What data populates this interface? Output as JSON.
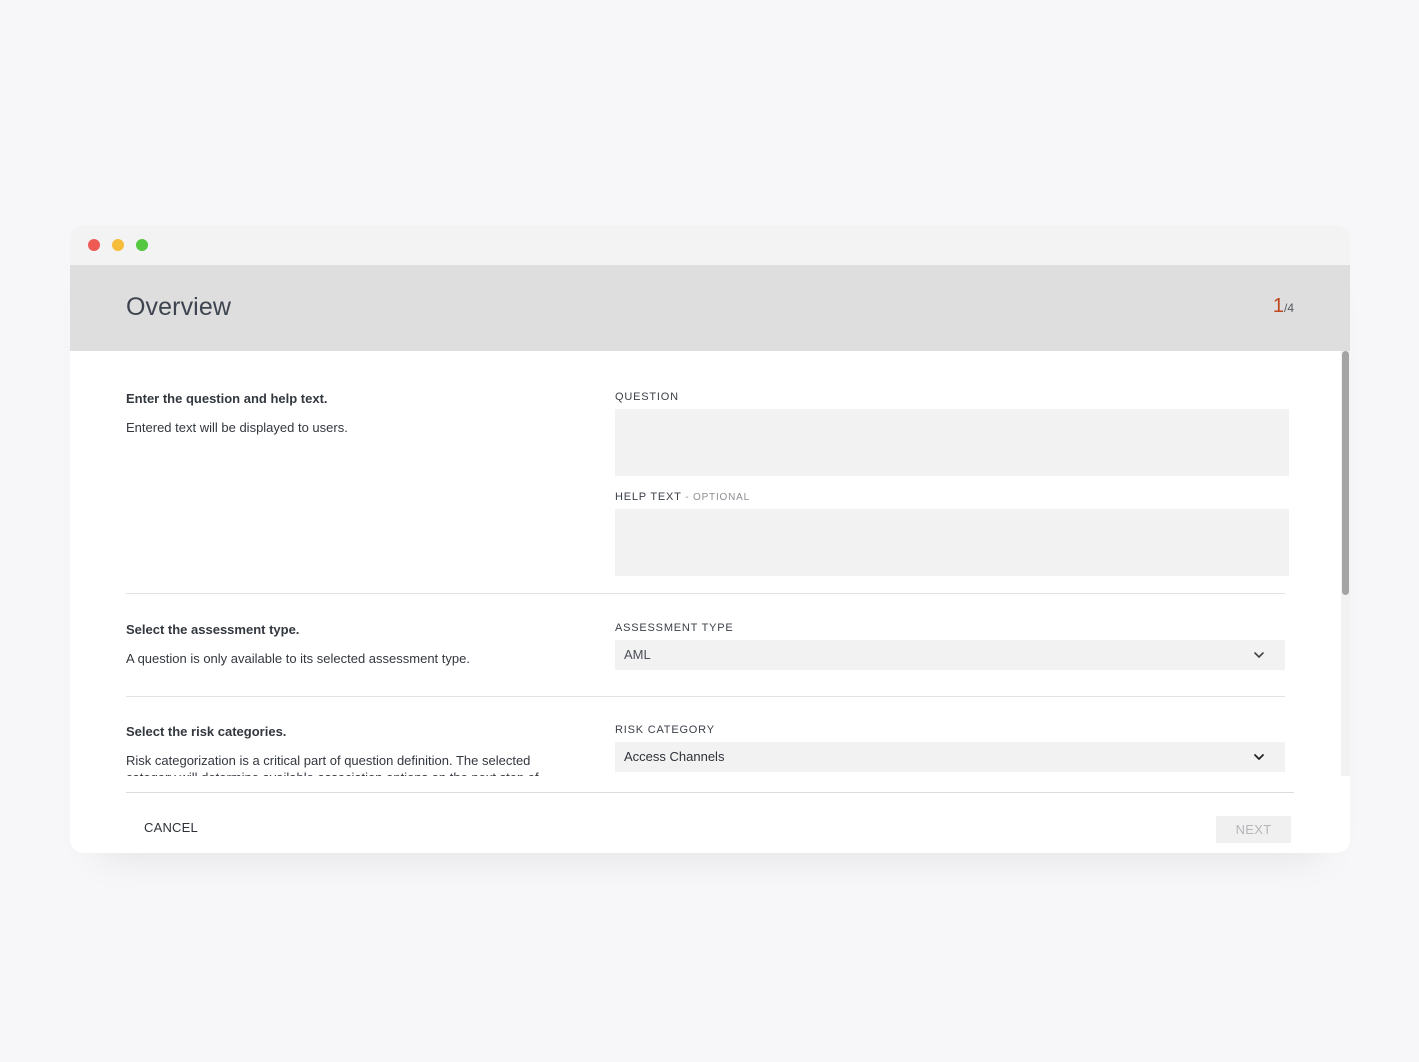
{
  "header": {
    "title": "Overview",
    "step_current": "1",
    "step_total": "/4"
  },
  "sections": {
    "question": {
      "heading": "Enter the question and help text.",
      "description": "Entered text will be displayed to users.",
      "question_label": "QUESTION",
      "question_value": "",
      "help_label": "HELP TEXT",
      "help_optional": " - OPTIONAL",
      "help_value": ""
    },
    "assessment": {
      "heading": "Select the assessment type.",
      "description": "A question is only available to its selected assessment type.",
      "label": "ASSESSMENT TYPE",
      "value": "AML",
      "value_color": "#4a4e55"
    },
    "risk": {
      "heading": "Select the risk categories.",
      "description": "Risk categorization is a critical part of question definition. The selected category will determine available association options on the next step of",
      "label": "RISK CATEGORY",
      "value": "Access Channels"
    }
  },
  "footer": {
    "cancel_label": "CANCEL",
    "next_label": "NEXT"
  },
  "icons": {
    "assessment_chevron": "chevron-down-icon",
    "risk_chevron": "chevron-down-icon"
  },
  "colors": {
    "accent": "#c0481e",
    "header_bg": "#dedede",
    "field_bg": "#f2f2f3"
  }
}
